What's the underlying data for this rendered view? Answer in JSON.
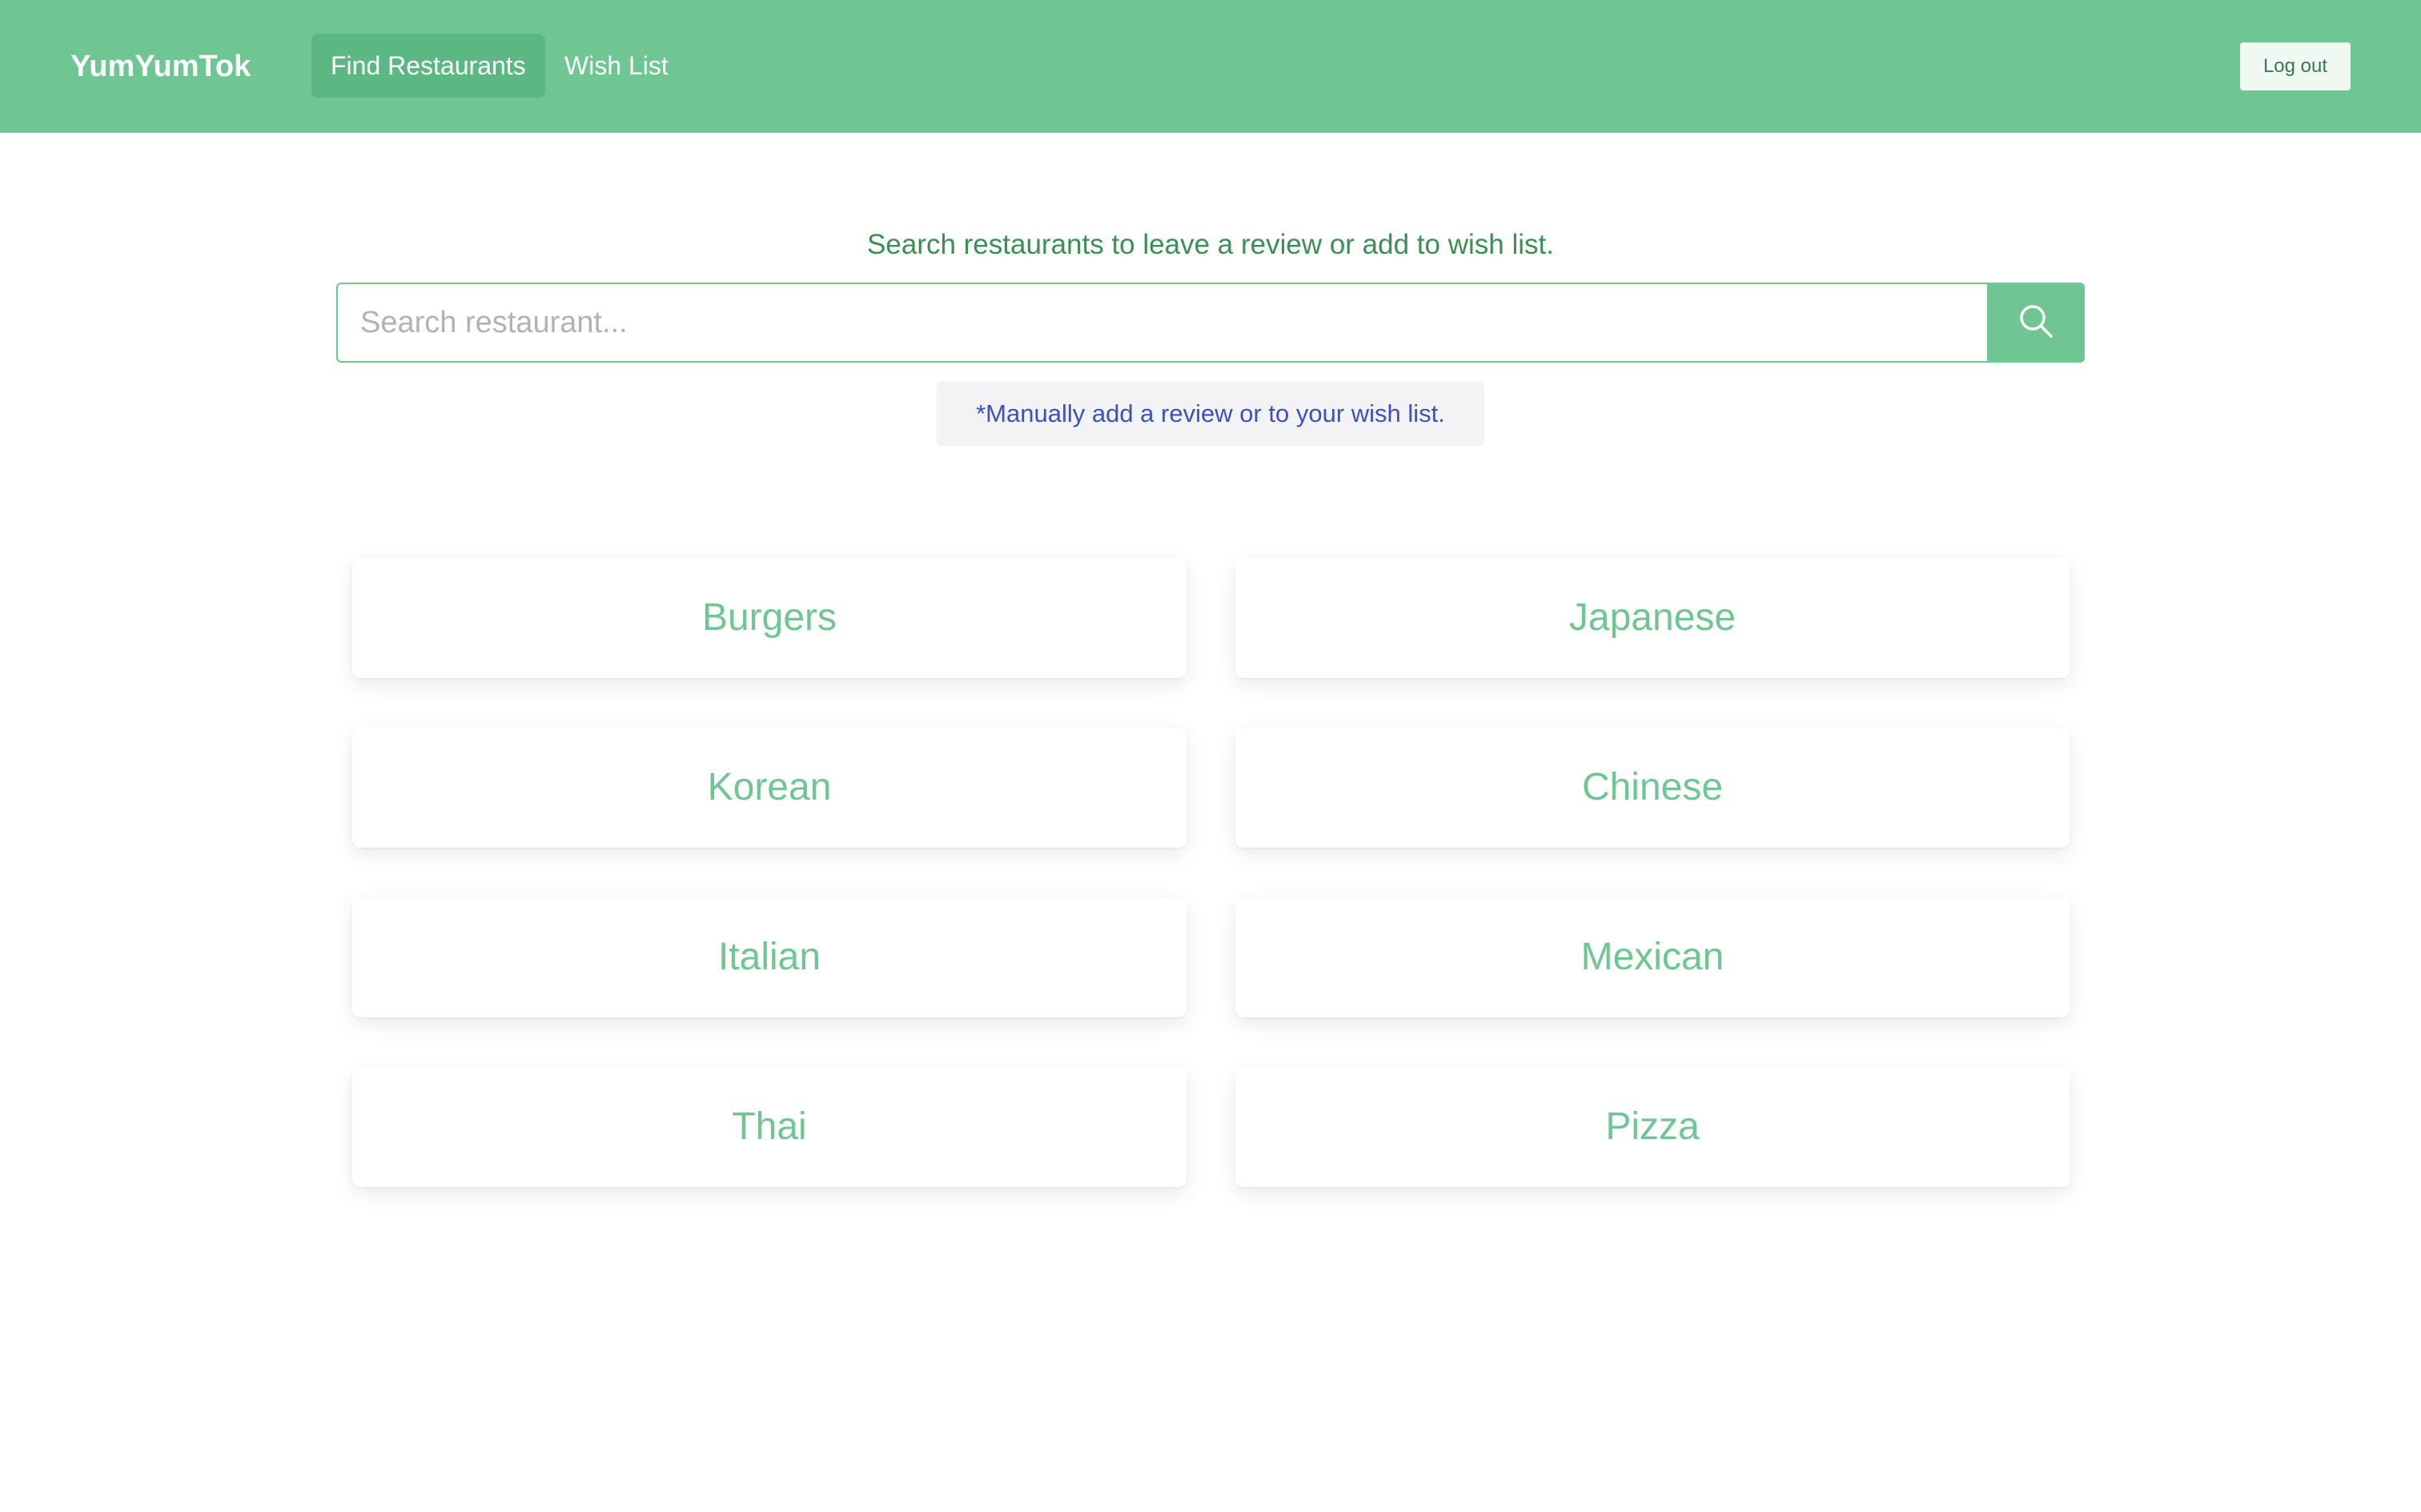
{
  "header": {
    "brand": "YumYumTok",
    "nav": [
      {
        "label": "Find Restaurants",
        "active": true
      },
      {
        "label": "Wish List",
        "active": false
      }
    ],
    "logout_label": "Log out",
    "background_color": "#6fc693"
  },
  "search": {
    "heading": "Search restaurants to leave a review or add to wish list.",
    "placeholder": "Search restaurant...",
    "value": "",
    "button_icon": "search-icon",
    "manual_note": "*Manually add a review or to your wish list."
  },
  "categories": [
    {
      "label": "Burgers"
    },
    {
      "label": "Japanese"
    },
    {
      "label": "Korean"
    },
    {
      "label": "Chinese"
    },
    {
      "label": "Italian"
    },
    {
      "label": "Mexican"
    },
    {
      "label": "Thai"
    },
    {
      "label": "Pizza"
    }
  ],
  "colors": {
    "accent": "#6fc693",
    "heading_text": "#3a8f54",
    "note_text": "#3d52b8"
  }
}
